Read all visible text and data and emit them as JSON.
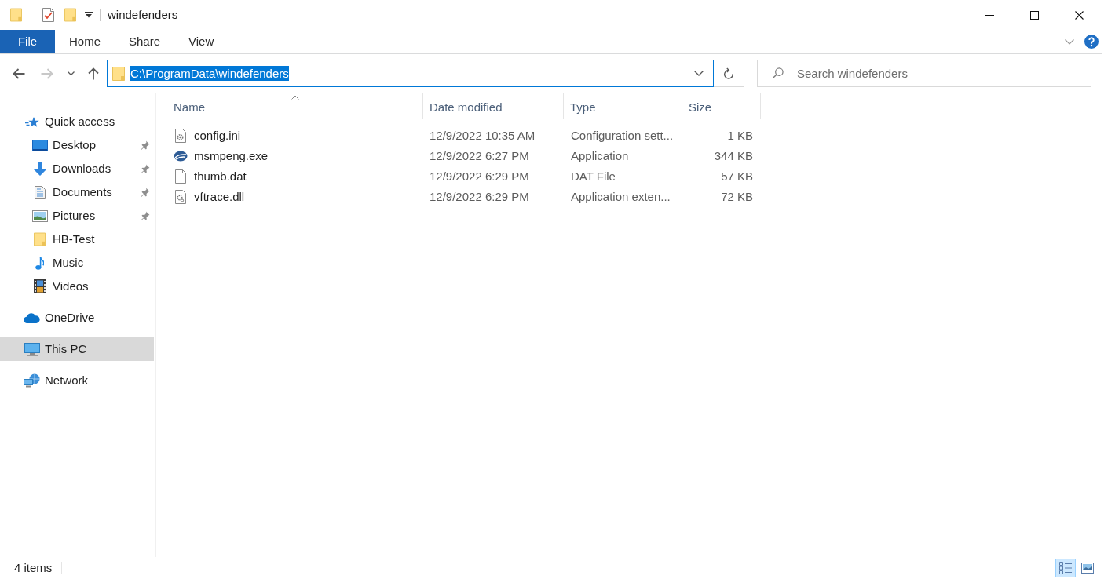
{
  "window": {
    "title": "windefenders"
  },
  "ribbon": {
    "tabs": [
      {
        "label": "File",
        "kind": "file"
      },
      {
        "label": "Home",
        "kind": "tab"
      },
      {
        "label": "Share",
        "kind": "tab"
      },
      {
        "label": "View",
        "kind": "tab"
      }
    ]
  },
  "navigation_buttons": [
    {
      "kind": "back",
      "disabled": false
    },
    {
      "kind": "forward",
      "disabled": true
    },
    {
      "kind": "recent",
      "disabled": false
    },
    {
      "kind": "up",
      "disabled": false
    }
  ],
  "address_bar": {
    "path": "C:\\ProgramData\\windefenders",
    "selected": true
  },
  "search": {
    "placeholder": "Search windefenders"
  },
  "navigation_pane": {
    "items": [
      {
        "label": "Quick access",
        "kind": "quickaccess",
        "selected": false,
        "children": [
          {
            "label": "Desktop",
            "kind": "desktop",
            "pinned": true,
            "selected": false
          },
          {
            "label": "Downloads",
            "kind": "downloads",
            "pinned": true,
            "selected": false
          },
          {
            "label": "Documents",
            "kind": "documents",
            "pinned": true,
            "selected": false
          },
          {
            "label": "Pictures",
            "kind": "pictures",
            "pinned": true,
            "selected": false
          },
          {
            "label": "HB-Test",
            "kind": "folder",
            "pinned": false,
            "selected": false
          },
          {
            "label": "Music",
            "kind": "music",
            "pinned": false,
            "selected": false
          },
          {
            "label": "Videos",
            "kind": "videos",
            "pinned": false,
            "selected": false
          }
        ]
      },
      {
        "label": "OneDrive",
        "kind": "cloud",
        "selected": false
      },
      {
        "label": "This PC",
        "kind": "computer",
        "selected": true
      },
      {
        "label": "Network",
        "kind": "network",
        "selected": false
      }
    ]
  },
  "file_list": {
    "columns": [
      {
        "label": "Name",
        "sorted": true
      },
      {
        "label": "Date modified",
        "sorted": false
      },
      {
        "label": "Type",
        "sorted": false
      },
      {
        "label": "Size",
        "sorted": false
      }
    ],
    "rows": [
      {
        "kind": "config",
        "name": "config.ini",
        "date_modified": "12/9/2022 10:35 AM",
        "type": "Configuration sett...",
        "size": "1 KB"
      },
      {
        "kind": "application",
        "name": "msmpeng.exe",
        "date_modified": "12/9/2022 6:27 PM",
        "type": "Application",
        "size": "344 KB"
      },
      {
        "kind": "data",
        "name": "thumb.dat",
        "date_modified": "12/9/2022 6:29 PM",
        "type": "DAT File",
        "size": "57 KB"
      },
      {
        "kind": "library",
        "name": "vftrace.dll",
        "date_modified": "12/9/2022 6:29 PM",
        "type": "Application exten...",
        "size": "72 KB"
      }
    ]
  },
  "status_bar": {
    "item_count": "4 items",
    "view_buttons": [
      {
        "kind": "details",
        "selected": true
      },
      {
        "kind": "icons",
        "selected": false
      }
    ]
  }
}
